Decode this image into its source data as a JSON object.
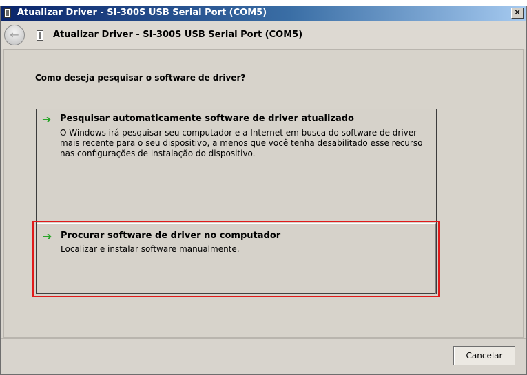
{
  "window": {
    "title": "Atualizar Driver - SI-300S USB Serial Port (COM5)",
    "close_label": "✕"
  },
  "nav": {
    "back_icon": "back-arrow-icon",
    "back_glyph": "←",
    "title": "Atualizar Driver - SI-300S USB Serial Port (COM5)"
  },
  "main": {
    "question": "Como deseja pesquisar o software de driver?",
    "options": [
      {
        "icon": "green-arrow-icon",
        "title": "Pesquisar automaticamente software de driver atualizado",
        "description": "O Windows irá pesquisar seu computador e a Internet em busca do software de driver mais recente para o seu dispositivo, a menos que você tenha desabilitado esse recurso nas configurações de instalação do dispositivo."
      },
      {
        "icon": "green-arrow-icon",
        "title": "Procurar software de driver no computador",
        "description": "Localizar e instalar software manualmente."
      }
    ]
  },
  "footer": {
    "cancel_label": "Cancelar"
  },
  "colors": {
    "arrow": "#2aa52a",
    "highlight": "#e01b1b",
    "titlebar": "#0a246a"
  }
}
